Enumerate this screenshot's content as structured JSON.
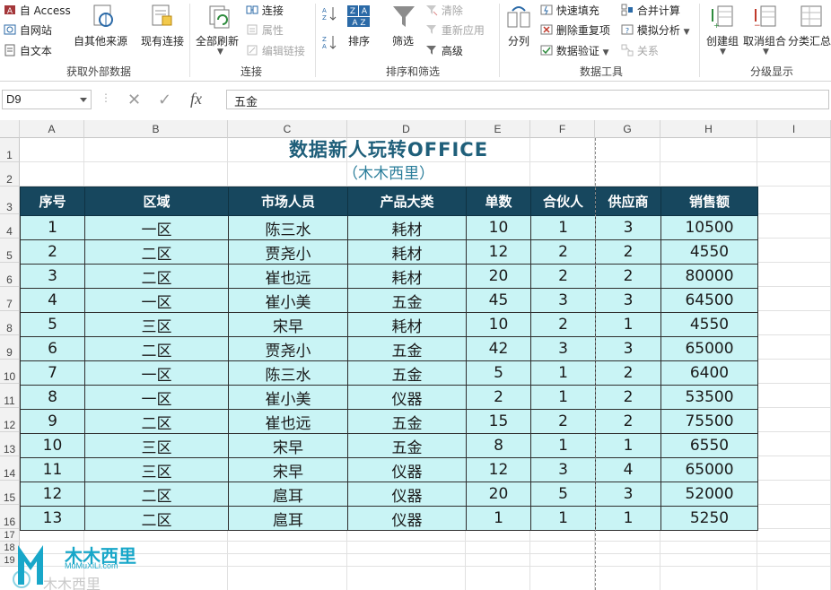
{
  "ribbon": {
    "groups": [
      {
        "label": "获取外部数据"
      },
      {
        "label": "连接"
      },
      {
        "label": "排序和筛选"
      },
      {
        "label": "数据工具"
      },
      {
        "label": "分级显示"
      }
    ],
    "ext_data": {
      "access": "自 Access",
      "web": "自网站",
      "text": "自文本",
      "other": "自其他来源",
      "existing": "现有连接"
    },
    "connections": {
      "refresh_all": "全部刷新",
      "connections": "连接",
      "properties": "属性",
      "edit_links": "编辑链接"
    },
    "sort_filter": {
      "sort": "排序",
      "filter": "筛选",
      "clear": "清除",
      "reapply": "重新应用",
      "advanced": "高级"
    },
    "data_tools": {
      "text_to_columns": "分列",
      "flash_fill": "快速填充",
      "remove_duplicates": "删除重复项",
      "data_validation": "数据验证",
      "consolidate": "合并计算",
      "what_if": "模拟分析",
      "relationships": "关系"
    },
    "outline": {
      "group": "创建组",
      "ungroup": "取消组合",
      "subtotal": "分类汇总"
    }
  },
  "formula_bar": {
    "name_box": "D9",
    "fx": "fx",
    "value": "五金"
  },
  "columns": [
    "A",
    "B",
    "C",
    "D",
    "E",
    "F",
    "G",
    "H",
    "I"
  ],
  "rows": [
    "1",
    "2",
    "3",
    "4",
    "5",
    "6",
    "7",
    "8",
    "9",
    "10",
    "11",
    "12",
    "13",
    "14",
    "15",
    "16",
    "17",
    "18",
    "19"
  ],
  "sheet": {
    "title": "数据新人玩转OFFICE",
    "subtitle": "（木木西里）",
    "headers": [
      "序号",
      "区域",
      "市场人员",
      "产品大类",
      "单数",
      "合伙人",
      "供应商",
      "销售额"
    ],
    "records": [
      [
        "1",
        "一区",
        "陈三水",
        "耗材",
        "10",
        "1",
        "3",
        "10500"
      ],
      [
        "2",
        "二区",
        "贾尧小",
        "耗材",
        "12",
        "2",
        "2",
        "4550"
      ],
      [
        "3",
        "二区",
        "崔也远",
        "耗材",
        "20",
        "2",
        "2",
        "80000"
      ],
      [
        "4",
        "一区",
        "崔小美",
        "五金",
        "45",
        "3",
        "3",
        "64500"
      ],
      [
        "5",
        "三区",
        "宋早",
        "耗材",
        "10",
        "2",
        "1",
        "4550"
      ],
      [
        "6",
        "二区",
        "贾尧小",
        "五金",
        "42",
        "3",
        "3",
        "65000"
      ],
      [
        "7",
        "一区",
        "陈三水",
        "五金",
        "5",
        "1",
        "2",
        "6400"
      ],
      [
        "8",
        "一区",
        "崔小美",
        "仪器",
        "2",
        "1",
        "2",
        "53500"
      ],
      [
        "9",
        "二区",
        "崔也远",
        "五金",
        "15",
        "2",
        "2",
        "75500"
      ],
      [
        "10",
        "三区",
        "宋早",
        "五金",
        "8",
        "1",
        "1",
        "6550"
      ],
      [
        "11",
        "三区",
        "宋早",
        "仪器",
        "12",
        "3",
        "4",
        "65000"
      ],
      [
        "12",
        "二区",
        "扈耳",
        "仪器",
        "20",
        "5",
        "3",
        "52000"
      ],
      [
        "13",
        "二区",
        "扈耳",
        "仪器",
        "1",
        "1",
        "1",
        "5250"
      ]
    ]
  },
  "watermark": {
    "brand": "木木西里",
    "sub": "木木西里",
    "url": "MuMuXiLi.com"
  },
  "colors": {
    "header_bg": "#17475e",
    "cell_bg": "#c9f4f5",
    "title": "#1f5f7a",
    "logo": "#18a7c9"
  }
}
